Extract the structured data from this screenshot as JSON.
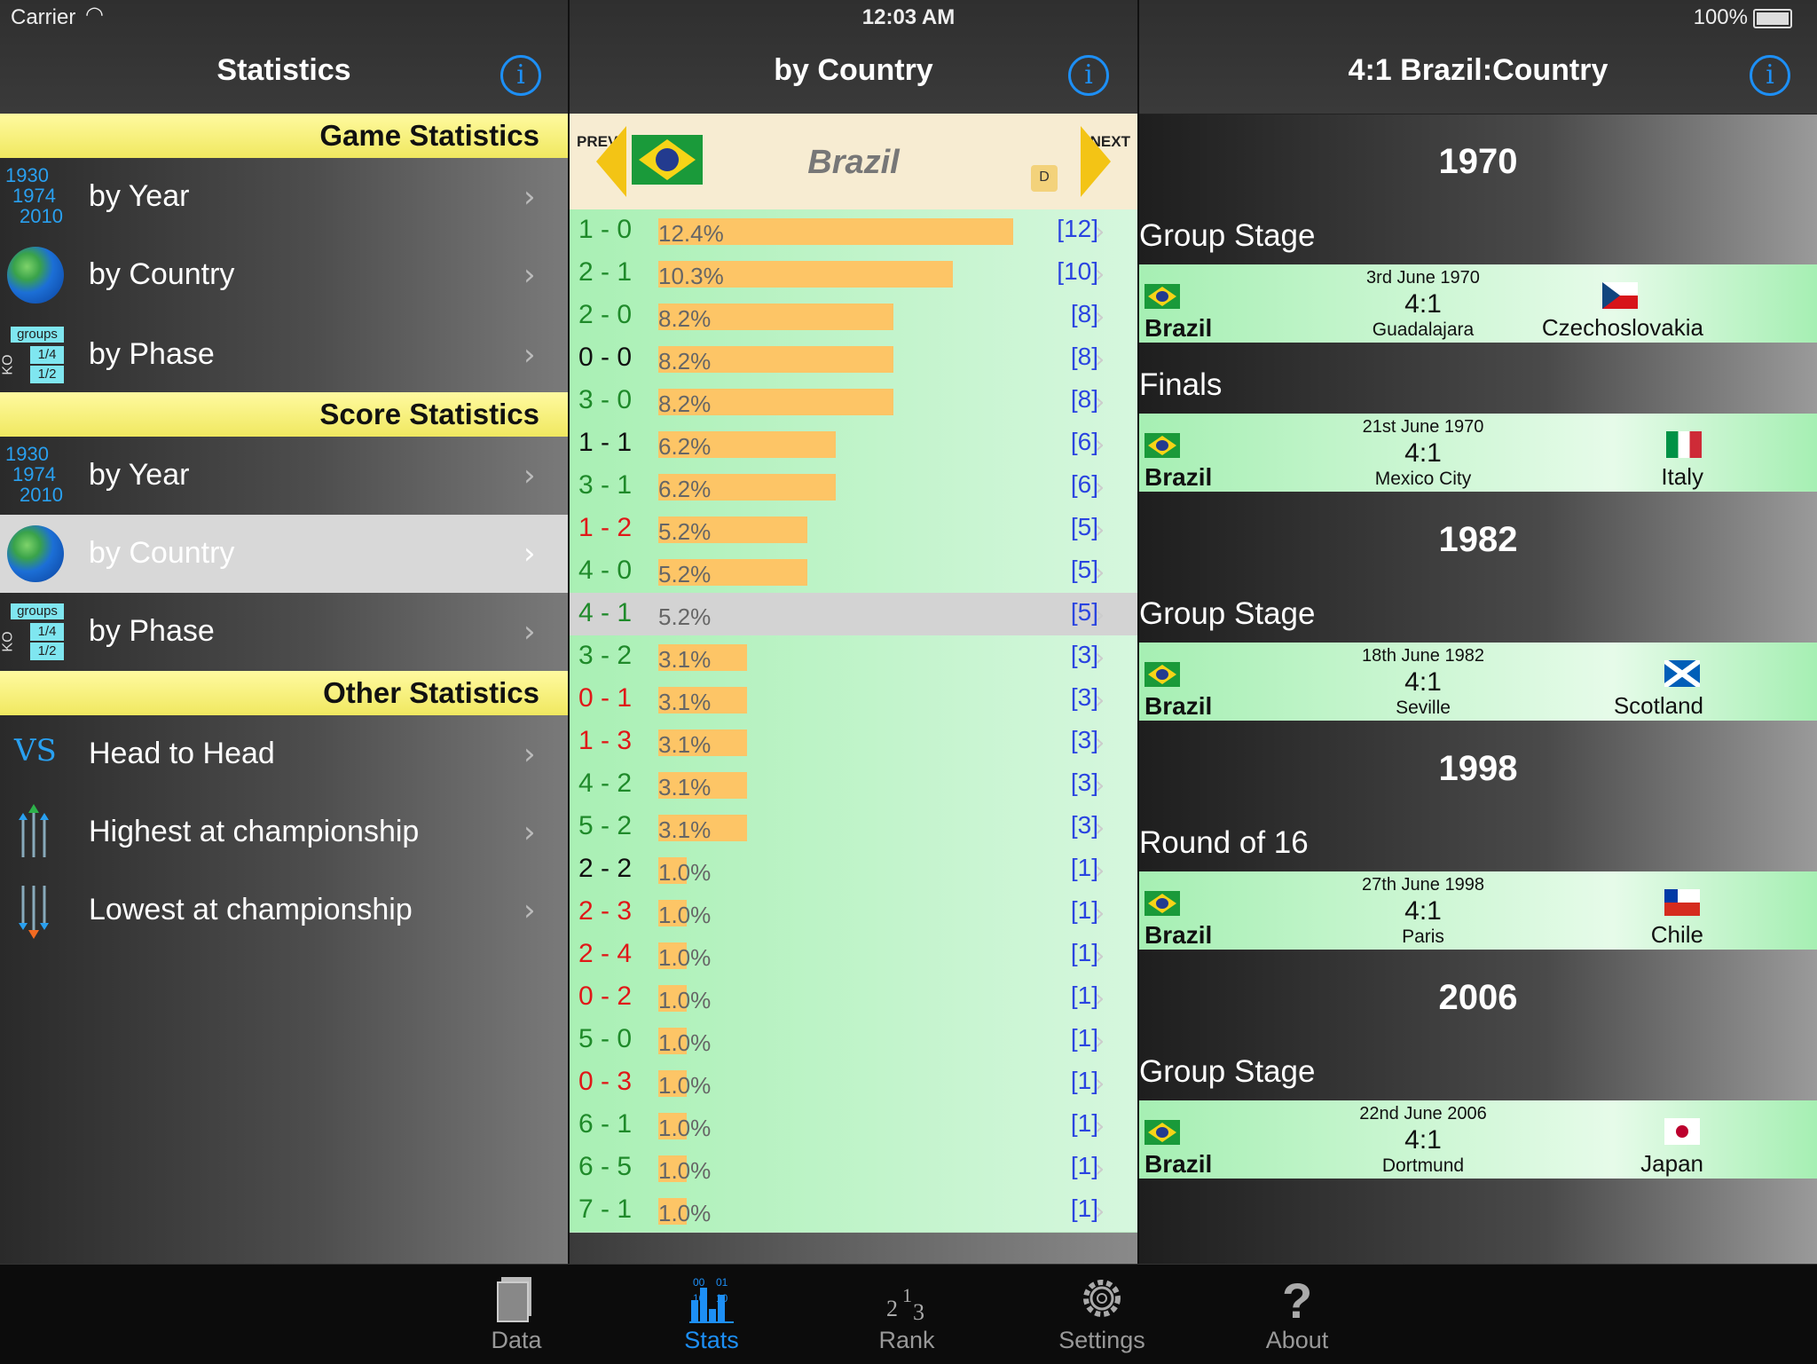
{
  "status": {
    "carrier": "Carrier",
    "time": "12:03 AM",
    "battery": "100%"
  },
  "left": {
    "title": "Statistics",
    "sections": [
      {
        "header": "Game Statistics",
        "items": [
          "by Year",
          "by Country",
          "by Phase"
        ]
      },
      {
        "header": "Score Statistics",
        "items": [
          "by Year",
          "by Country",
          "by Phase"
        ]
      },
      {
        "header": "Other Statistics",
        "items": [
          "Head to Head",
          "Highest at championship",
          "Lowest at championship"
        ]
      }
    ],
    "year_icon": [
      "1930",
      "1974",
      "2010"
    ],
    "phase_icon": {
      "groups": "groups",
      "ko": "KO",
      "quarter": "1/4",
      "half": "1/2"
    },
    "vs_icon": "VS",
    "selected": "by Country (Score Statistics)"
  },
  "middle": {
    "title": "by Country",
    "prev": "PREV",
    "next": "NEXT",
    "country": "Brazil",
    "badge": "D",
    "selected_score": "4 - 1",
    "rows": [
      {
        "score": "1 - 0",
        "pct": "12.4%",
        "count": "[12]",
        "color": "green"
      },
      {
        "score": "2 - 1",
        "pct": "10.3%",
        "count": "[10]",
        "color": "green"
      },
      {
        "score": "2 - 0",
        "pct": "8.2%",
        "count": "[8]",
        "color": "green"
      },
      {
        "score": "0 - 0",
        "pct": "8.2%",
        "count": "[8]",
        "color": "black"
      },
      {
        "score": "3 - 0",
        "pct": "8.2%",
        "count": "[8]",
        "color": "green"
      },
      {
        "score": "1 - 1",
        "pct": "6.2%",
        "count": "[6]",
        "color": "black"
      },
      {
        "score": "3 - 1",
        "pct": "6.2%",
        "count": "[6]",
        "color": "green"
      },
      {
        "score": "1 - 2",
        "pct": "5.2%",
        "count": "[5]",
        "color": "red"
      },
      {
        "score": "4 - 0",
        "pct": "5.2%",
        "count": "[5]",
        "color": "green"
      },
      {
        "score": "4 - 1",
        "pct": "5.2%",
        "count": "[5]",
        "color": "green"
      },
      {
        "score": "3 - 2",
        "pct": "3.1%",
        "count": "[3]",
        "color": "green"
      },
      {
        "score": "0 - 1",
        "pct": "3.1%",
        "count": "[3]",
        "color": "red"
      },
      {
        "score": "1 - 3",
        "pct": "3.1%",
        "count": "[3]",
        "color": "red"
      },
      {
        "score": "4 - 2",
        "pct": "3.1%",
        "count": "[3]",
        "color": "green"
      },
      {
        "score": "5 - 2",
        "pct": "3.1%",
        "count": "[3]",
        "color": "green"
      },
      {
        "score": "2 - 2",
        "pct": "1.0%",
        "count": "[1]",
        "color": "black"
      },
      {
        "score": "2 - 3",
        "pct": "1.0%",
        "count": "[1]",
        "color": "red"
      },
      {
        "score": "2 - 4",
        "pct": "1.0%",
        "count": "[1]",
        "color": "red"
      },
      {
        "score": "0 - 2",
        "pct": "1.0%",
        "count": "[1]",
        "color": "red"
      },
      {
        "score": "5 - 0",
        "pct": "1.0%",
        "count": "[1]",
        "color": "green"
      },
      {
        "score": "0 - 3",
        "pct": "1.0%",
        "count": "[1]",
        "color": "red"
      },
      {
        "score": "6 - 1",
        "pct": "1.0%",
        "count": "[1]",
        "color": "green"
      },
      {
        "score": "6 - 5",
        "pct": "1.0%",
        "count": "[1]",
        "color": "green"
      },
      {
        "score": "7 - 1",
        "pct": "1.0%",
        "count": "[1]",
        "color": "green"
      }
    ]
  },
  "right": {
    "title": "4:1 Brazil:Country",
    "groups": [
      {
        "year": "1970",
        "phases": [
          {
            "phase": "Group Stage",
            "match": {
              "date": "3rd June 1970",
              "result": "4:1",
              "city": "Guadalajara",
              "home": "Brazil",
              "away": "Czechoslovakia",
              "away_flag": "f-cz"
            }
          },
          {
            "phase": "Finals",
            "match": {
              "date": "21st June 1970",
              "result": "4:1",
              "city": "Mexico City",
              "home": "Brazil",
              "away": "Italy",
              "away_flag": "f-it"
            }
          }
        ]
      },
      {
        "year": "1982",
        "phases": [
          {
            "phase": "Group Stage",
            "match": {
              "date": "18th June 1982",
              "result": "4:1",
              "city": "Seville",
              "home": "Brazil",
              "away": "Scotland",
              "away_flag": "f-sco"
            }
          }
        ]
      },
      {
        "year": "1998",
        "phases": [
          {
            "phase": "Round of 16",
            "match": {
              "date": "27th June 1998",
              "result": "4:1",
              "city": "Paris",
              "home": "Brazil",
              "away": "Chile",
              "away_flag": "f-chi"
            }
          }
        ]
      },
      {
        "year": "2006",
        "phases": [
          {
            "phase": "Group Stage",
            "match": {
              "date": "22nd June 2006",
              "result": "4:1",
              "city": "Dortmund",
              "home": "Brazil",
              "away": "Japan",
              "away_flag": "f-jp"
            }
          }
        ]
      }
    ]
  },
  "tabs": [
    {
      "label": "Data",
      "icon": "book-icon",
      "active": false
    },
    {
      "label": "Stats",
      "icon": "stats-chart-icon",
      "active": true
    },
    {
      "label": "Rank",
      "icon": "rank-icon",
      "active": false
    },
    {
      "label": "Settings",
      "icon": "gear-icon",
      "active": false
    },
    {
      "label": "About",
      "icon": "question-icon",
      "active": false
    }
  ],
  "stats_icon_digits": [
    "00",
    "01",
    "10",
    "10"
  ],
  "rank_icon_digits": [
    "2",
    "1",
    "3"
  ],
  "colors": {
    "accent": "#1d8ff5",
    "section_yellow": "#f0e860",
    "bar_orange": "#fdc566",
    "win_green": "#1f8a2a",
    "loss_red": "#e01818"
  }
}
